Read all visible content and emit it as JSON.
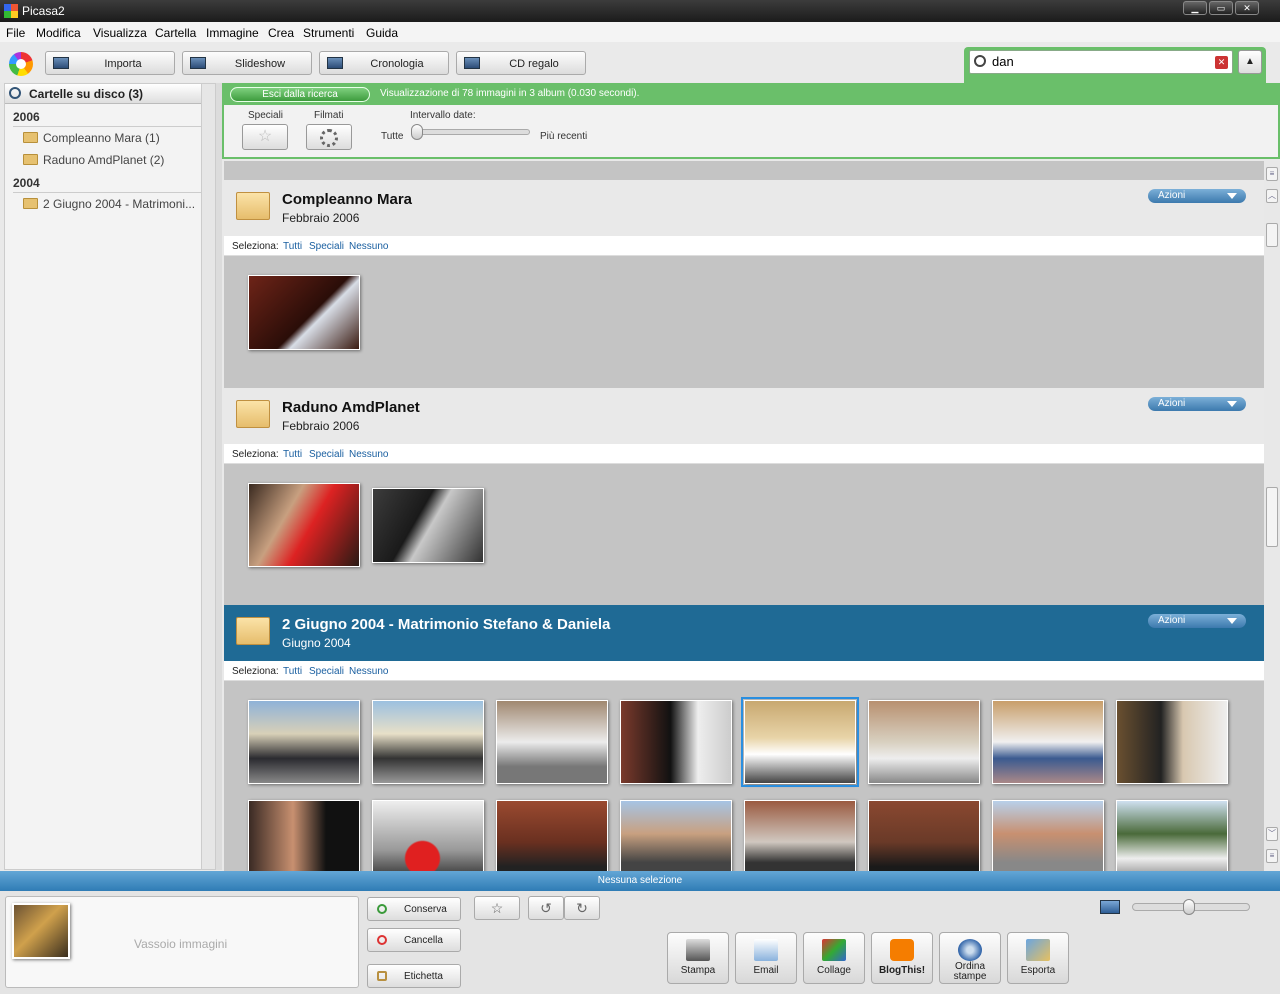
{
  "window": {
    "title": "Picasa2"
  },
  "menu": [
    "File",
    "Modifica",
    "Visualizza",
    "Cartella",
    "Immagine",
    "Crea",
    "Strumenti",
    "Guida"
  ],
  "toolbar": {
    "importa": "Importa",
    "slideshow": "Slideshow",
    "cronologia": "Cronologia",
    "cd": "CD regalo"
  },
  "search": {
    "value": "dan"
  },
  "sidebar": {
    "header": "Cartelle su disco (3)",
    "groups": [
      {
        "year": "2006",
        "items": [
          "Compleanno Mara (1)",
          "Raduno AmdPlanet (2)"
        ]
      },
      {
        "year": "2004",
        "items": [
          "2 Giugno 2004 - Matrimoni..."
        ]
      }
    ]
  },
  "results": {
    "exit": "Esci dalla ricerca",
    "message": "Visualizzazione di 78 immagini in 3 album (0.030 secondi)."
  },
  "filters": {
    "speciali": "Speciali",
    "filmati": "Filmati",
    "intervallo": "Intervallo date:",
    "tutte": "Tutte",
    "recenti": "Più recenti"
  },
  "select": {
    "label": "Seleziona:",
    "all": "Tutti",
    "special": "Speciali",
    "none": "Nessuno"
  },
  "albums": [
    {
      "name": "Compleanno Mara",
      "date": "Febbraio 2006",
      "action": "Azioni"
    },
    {
      "name": "Raduno AmdPlanet",
      "date": "Febbraio 2006",
      "action": "Azioni"
    },
    {
      "name": "2 Giugno 2004 - Matrimonio Stefano & Daniela",
      "date": "Giugno 2004",
      "action": "Azioni"
    }
  ],
  "status": {
    "selection": "Nessuna selezione"
  },
  "tray": {
    "label": "Vassoio immagini",
    "conserva": "Conserva",
    "cancella": "Cancella",
    "etichetta": "Etichetta"
  },
  "export": {
    "stampa": "Stampa",
    "email": "Email",
    "collage": "Collage",
    "blog": "BlogThis!",
    "ordina1": "Ordina",
    "ordina2": "stampe",
    "esporta": "Esporta"
  },
  "colors": {
    "accent_green": "#6abf6a",
    "selected_album": "#1f6a95",
    "status_blue": "#2f7cb5"
  }
}
